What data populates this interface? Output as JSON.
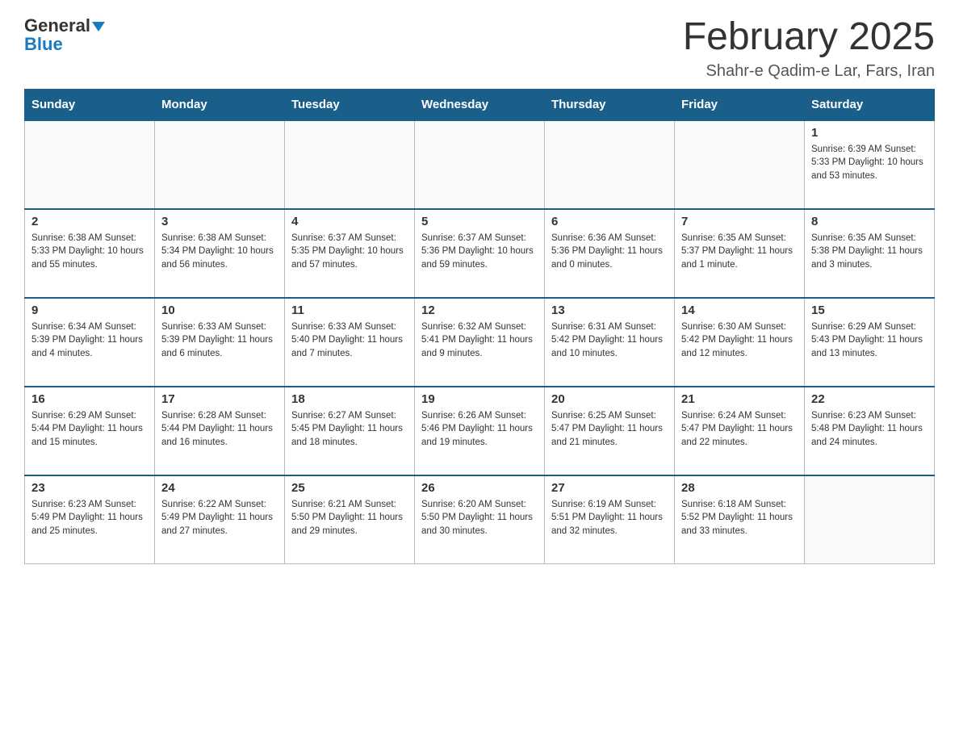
{
  "header": {
    "logo_line1": "General",
    "logo_line2": "Blue",
    "month": "February 2025",
    "location": "Shahr-e Qadim-e Lar, Fars, Iran"
  },
  "days_of_week": [
    "Sunday",
    "Monday",
    "Tuesday",
    "Wednesday",
    "Thursday",
    "Friday",
    "Saturday"
  ],
  "weeks": [
    [
      {
        "day": "",
        "info": ""
      },
      {
        "day": "",
        "info": ""
      },
      {
        "day": "",
        "info": ""
      },
      {
        "day": "",
        "info": ""
      },
      {
        "day": "",
        "info": ""
      },
      {
        "day": "",
        "info": ""
      },
      {
        "day": "1",
        "info": "Sunrise: 6:39 AM\nSunset: 5:33 PM\nDaylight: 10 hours\nand 53 minutes."
      }
    ],
    [
      {
        "day": "2",
        "info": "Sunrise: 6:38 AM\nSunset: 5:33 PM\nDaylight: 10 hours\nand 55 minutes."
      },
      {
        "day": "3",
        "info": "Sunrise: 6:38 AM\nSunset: 5:34 PM\nDaylight: 10 hours\nand 56 minutes."
      },
      {
        "day": "4",
        "info": "Sunrise: 6:37 AM\nSunset: 5:35 PM\nDaylight: 10 hours\nand 57 minutes."
      },
      {
        "day": "5",
        "info": "Sunrise: 6:37 AM\nSunset: 5:36 PM\nDaylight: 10 hours\nand 59 minutes."
      },
      {
        "day": "6",
        "info": "Sunrise: 6:36 AM\nSunset: 5:36 PM\nDaylight: 11 hours\nand 0 minutes."
      },
      {
        "day": "7",
        "info": "Sunrise: 6:35 AM\nSunset: 5:37 PM\nDaylight: 11 hours\nand 1 minute."
      },
      {
        "day": "8",
        "info": "Sunrise: 6:35 AM\nSunset: 5:38 PM\nDaylight: 11 hours\nand 3 minutes."
      }
    ],
    [
      {
        "day": "9",
        "info": "Sunrise: 6:34 AM\nSunset: 5:39 PM\nDaylight: 11 hours\nand 4 minutes."
      },
      {
        "day": "10",
        "info": "Sunrise: 6:33 AM\nSunset: 5:39 PM\nDaylight: 11 hours\nand 6 minutes."
      },
      {
        "day": "11",
        "info": "Sunrise: 6:33 AM\nSunset: 5:40 PM\nDaylight: 11 hours\nand 7 minutes."
      },
      {
        "day": "12",
        "info": "Sunrise: 6:32 AM\nSunset: 5:41 PM\nDaylight: 11 hours\nand 9 minutes."
      },
      {
        "day": "13",
        "info": "Sunrise: 6:31 AM\nSunset: 5:42 PM\nDaylight: 11 hours\nand 10 minutes."
      },
      {
        "day": "14",
        "info": "Sunrise: 6:30 AM\nSunset: 5:42 PM\nDaylight: 11 hours\nand 12 minutes."
      },
      {
        "day": "15",
        "info": "Sunrise: 6:29 AM\nSunset: 5:43 PM\nDaylight: 11 hours\nand 13 minutes."
      }
    ],
    [
      {
        "day": "16",
        "info": "Sunrise: 6:29 AM\nSunset: 5:44 PM\nDaylight: 11 hours\nand 15 minutes."
      },
      {
        "day": "17",
        "info": "Sunrise: 6:28 AM\nSunset: 5:44 PM\nDaylight: 11 hours\nand 16 minutes."
      },
      {
        "day": "18",
        "info": "Sunrise: 6:27 AM\nSunset: 5:45 PM\nDaylight: 11 hours\nand 18 minutes."
      },
      {
        "day": "19",
        "info": "Sunrise: 6:26 AM\nSunset: 5:46 PM\nDaylight: 11 hours\nand 19 minutes."
      },
      {
        "day": "20",
        "info": "Sunrise: 6:25 AM\nSunset: 5:47 PM\nDaylight: 11 hours\nand 21 minutes."
      },
      {
        "day": "21",
        "info": "Sunrise: 6:24 AM\nSunset: 5:47 PM\nDaylight: 11 hours\nand 22 minutes."
      },
      {
        "day": "22",
        "info": "Sunrise: 6:23 AM\nSunset: 5:48 PM\nDaylight: 11 hours\nand 24 minutes."
      }
    ],
    [
      {
        "day": "23",
        "info": "Sunrise: 6:23 AM\nSunset: 5:49 PM\nDaylight: 11 hours\nand 25 minutes."
      },
      {
        "day": "24",
        "info": "Sunrise: 6:22 AM\nSunset: 5:49 PM\nDaylight: 11 hours\nand 27 minutes."
      },
      {
        "day": "25",
        "info": "Sunrise: 6:21 AM\nSunset: 5:50 PM\nDaylight: 11 hours\nand 29 minutes."
      },
      {
        "day": "26",
        "info": "Sunrise: 6:20 AM\nSunset: 5:50 PM\nDaylight: 11 hours\nand 30 minutes."
      },
      {
        "day": "27",
        "info": "Sunrise: 6:19 AM\nSunset: 5:51 PM\nDaylight: 11 hours\nand 32 minutes."
      },
      {
        "day": "28",
        "info": "Sunrise: 6:18 AM\nSunset: 5:52 PM\nDaylight: 11 hours\nand 33 minutes."
      },
      {
        "day": "",
        "info": ""
      }
    ]
  ]
}
